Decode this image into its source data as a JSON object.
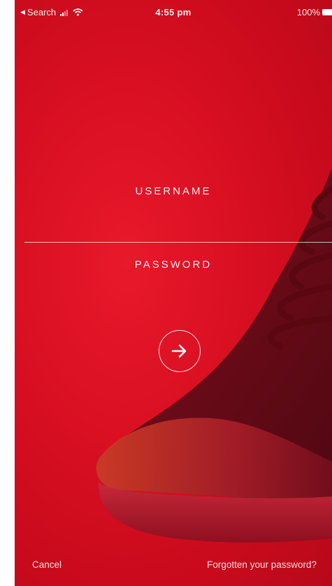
{
  "status_bar": {
    "back_label": "Search",
    "time": "4:55 pm",
    "battery": "100%"
  },
  "login_form": {
    "username_label": "USERNAME",
    "password_label": "PASSWORD"
  },
  "footer": {
    "cancel_label": "Cancel",
    "forgot_label": "Forgotten your password?"
  },
  "colors": {
    "background": "#d90f22",
    "shoe": "#6e0c18",
    "text": "#ffffff"
  },
  "icons": {
    "submit": "arrow-right-icon",
    "signal": "signal-icon",
    "wifi": "wifi-icon",
    "battery": "battery-icon"
  }
}
